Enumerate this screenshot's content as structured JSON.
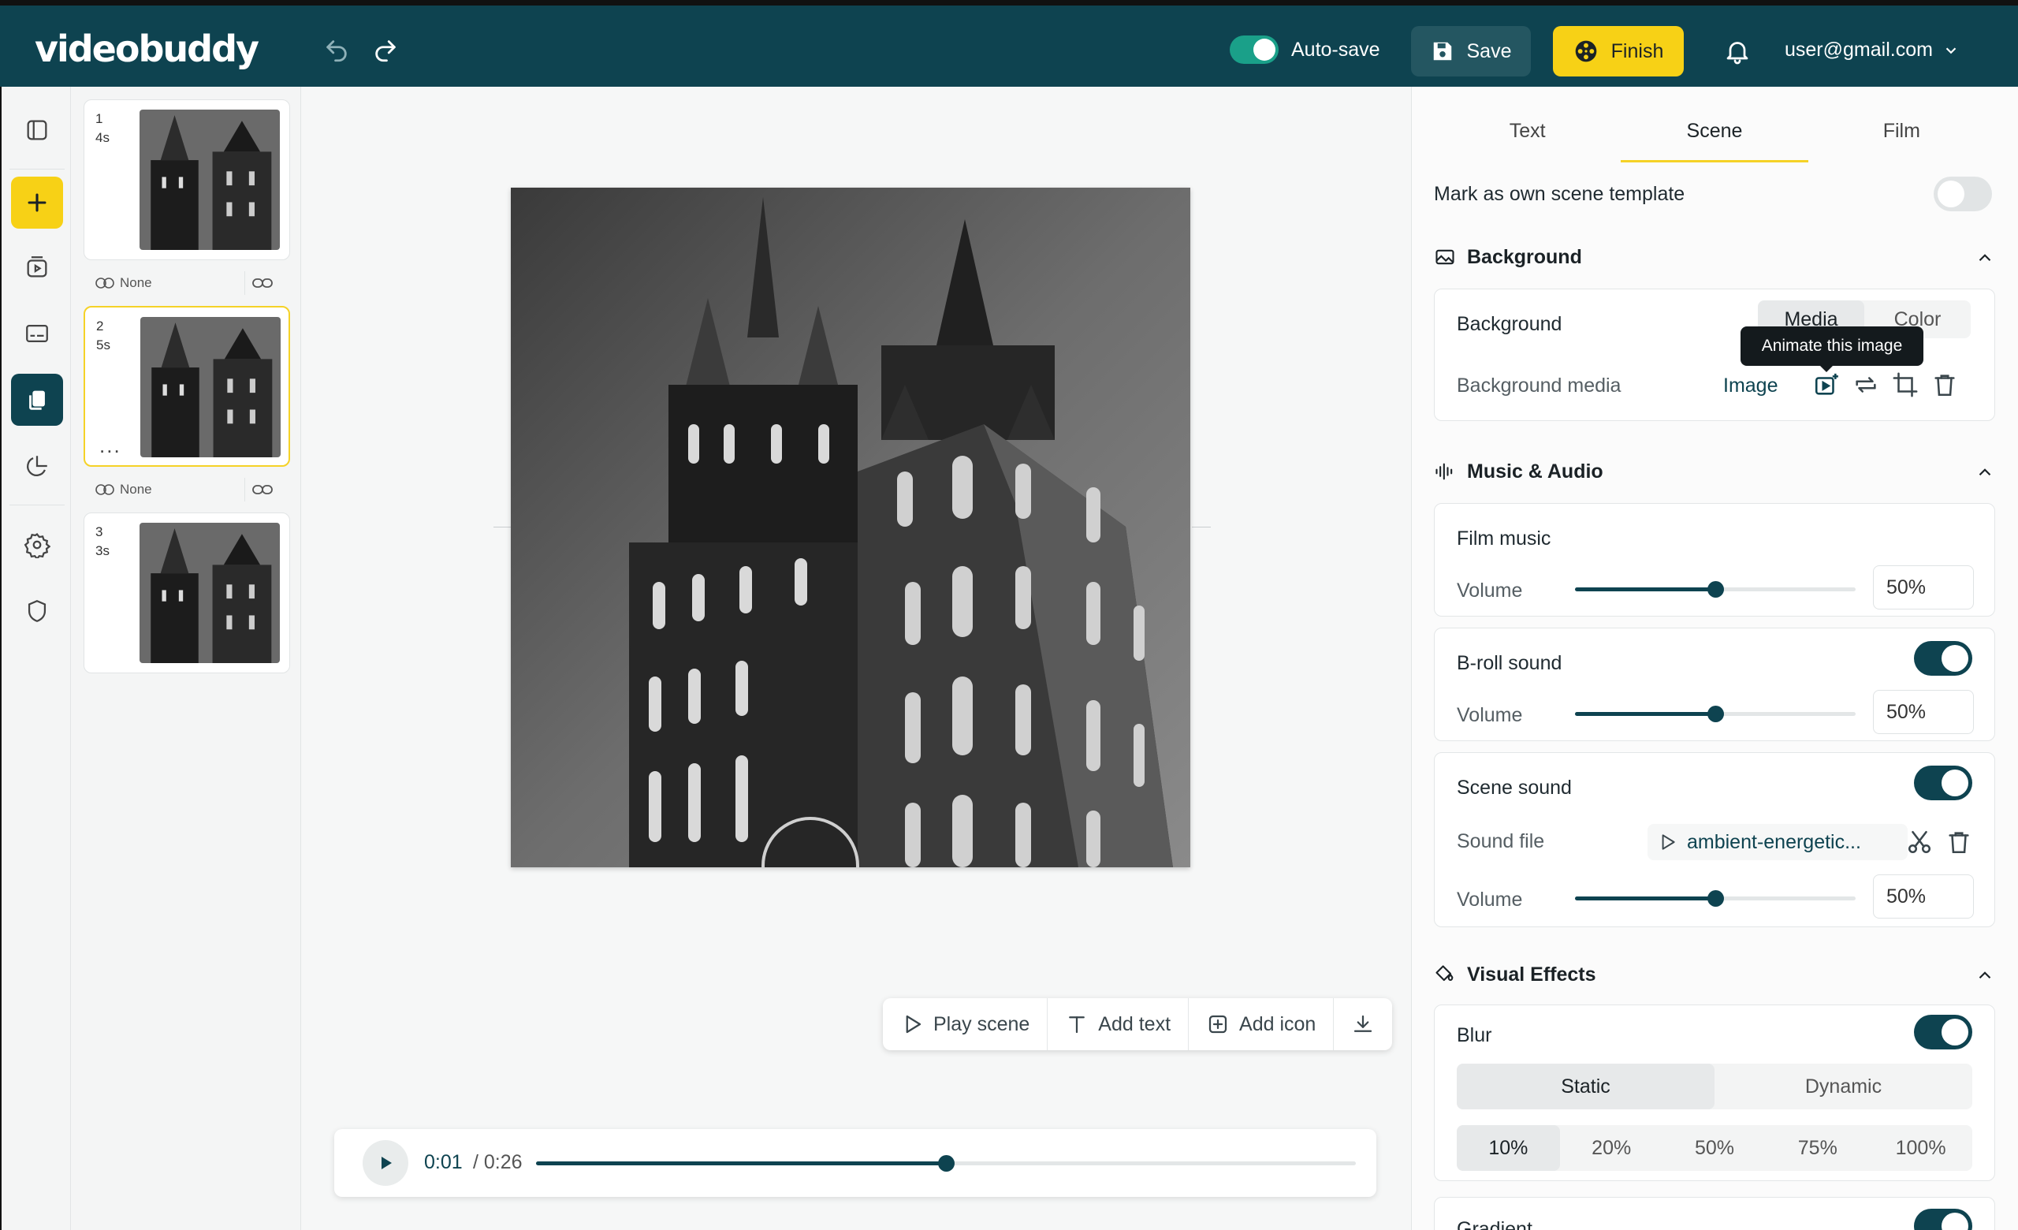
{
  "header": {
    "logo": "videobuddy",
    "autosave_label": "Auto-save",
    "save_label": "Save",
    "finish_label": "Finish",
    "user_email": "user@gmail.com"
  },
  "scenes": [
    {
      "number": "1",
      "duration": "4s",
      "transition": "None"
    },
    {
      "number": "2",
      "duration": "5s",
      "transition": "None",
      "more": "..."
    },
    {
      "number": "3",
      "duration": "3s"
    }
  ],
  "toolbar": {
    "play_scene": "Play scene",
    "add_text": "Add text",
    "add_icon": "Add icon"
  },
  "player": {
    "current_time": "0:01",
    "total_time": "/ 0:26",
    "progress_fraction": 0.5
  },
  "panel": {
    "tabs": [
      "Text",
      "Scene",
      "Film"
    ],
    "active_tab": "Scene",
    "mark_template_label": "Mark as own scene template",
    "background": {
      "title": "Background",
      "row_label": "Background",
      "options": [
        "Media",
        "Color"
      ],
      "media_label": "Background media",
      "media_type": "Image",
      "tooltip": "Animate this image"
    },
    "music": {
      "title": "Music & Audio",
      "film_music_label": "Film music",
      "film_music_volume": "50%",
      "broll_label": "B-roll sound",
      "broll_volume": "50%",
      "scene_sound_label": "Scene sound",
      "sound_file_label": "Sound file",
      "sound_file_name": "ambient-energetic...",
      "scene_sound_volume": "50%",
      "volume_label": "Volume",
      "volume_fraction": 0.5
    },
    "effects": {
      "title": "Visual Effects",
      "blur_label": "Blur",
      "blur_modes": [
        "Static",
        "Dynamic"
      ],
      "blur_levels": [
        "10%",
        "20%",
        "50%",
        "75%",
        "100%"
      ],
      "gradient_label": "Gradient"
    }
  },
  "colors": {
    "brand": "#0e4350",
    "accent": "#f7d116",
    "toggle_on": "#1aa089"
  }
}
